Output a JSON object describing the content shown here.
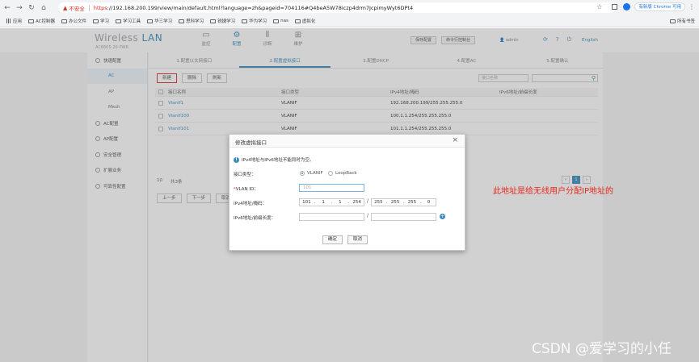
{
  "browser": {
    "security_label": "不安全",
    "url_scheme": "https",
    "url_rest": "://192.168.200.199/view/main/default.html?language=zh&pageid=704116#Q4beA5W78iczp4drm7JcpimyWyt6DPt4",
    "update_button": "有新版 Chrome 可用",
    "bookmarks": [
      "应用",
      "AC控制器",
      "办公文件",
      "学习",
      "学习工具",
      "华三学习",
      "思科学习",
      "锐捷学习",
      "华为学习",
      "nas",
      "虚拟化"
    ],
    "bookmarks_right": "所有书签"
  },
  "app": {
    "logo_main": "Wireless",
    "logo_lan": "LAN",
    "logo_sub": "AC6605-26-PWR",
    "top_nav": [
      {
        "label": "监控",
        "icon": "▭"
      },
      {
        "label": "配置",
        "icon": "⚙"
      },
      {
        "label": "诊断",
        "icon": "⦀"
      },
      {
        "label": "维护",
        "icon": "⊞"
      }
    ],
    "save_config": "保存配置",
    "cli_button": "命令行控制台",
    "user": "admin",
    "lang": "English"
  },
  "sidebar": {
    "items": [
      {
        "label": "快速配置",
        "type": "group"
      },
      {
        "label": "AC",
        "type": "sub",
        "active": true
      },
      {
        "label": "AP",
        "type": "sub"
      },
      {
        "label": "Mesh",
        "type": "sub"
      },
      {
        "label": "AC配置",
        "type": "group"
      },
      {
        "label": "AP配置",
        "type": "group"
      },
      {
        "label": "安全管理",
        "type": "group"
      },
      {
        "label": "扩展业务",
        "type": "group"
      },
      {
        "label": "可靠性配置",
        "type": "group"
      }
    ]
  },
  "steps": [
    "1.配置以太网接口",
    "2.配置虚拟接口",
    "3.配置DHCP",
    "4.配置AC",
    "5.配置确认"
  ],
  "toolbar": {
    "new": "新建",
    "delete": "删除",
    "refresh": "刷新",
    "filter_placeholder": "接口名称"
  },
  "table": {
    "headers": [
      "接口名称",
      "接口类型",
      "IPv4地址/掩码",
      "IPv6地址/前缀长度"
    ],
    "rows": [
      [
        "Vlanif1",
        "VLANIF",
        "192.168.200.199/255.255.255.0",
        ""
      ],
      [
        "Vlanif100",
        "VLANIF",
        "100.1.1.254/255.255.255.0",
        ""
      ],
      [
        "Vlanif101",
        "VLANIF",
        "101.1.1.254/255.255.255.0",
        ""
      ]
    ]
  },
  "pager": {
    "per_page": "10",
    "total": "共3条",
    "prev": "上一步",
    "next": "下一步",
    "cancel": "取消",
    "page": "1"
  },
  "dialog": {
    "title": "修改虚拟接口",
    "tip": "IPv4地址与IPv6地址不能同时为空。",
    "iftype_label": "接口类型：",
    "opt_vlanif": "VLANIF",
    "opt_loopback": "LoopBack",
    "vlan_label": "VLAN ID：",
    "vlan_value": "101",
    "ipv4_label": "IPv4地址/掩码：",
    "ipv4": [
      "101",
      "1",
      "1",
      "254"
    ],
    "mask": [
      "255",
      "255",
      "255",
      "0"
    ],
    "ipv6_label": "IPv6地址/前缀长度：",
    "ok": "确定",
    "cancel": "取消"
  },
  "annotation": "此地址是给无线用户分配IP地址的",
  "watermark": "CSDN @爱学习的小任"
}
